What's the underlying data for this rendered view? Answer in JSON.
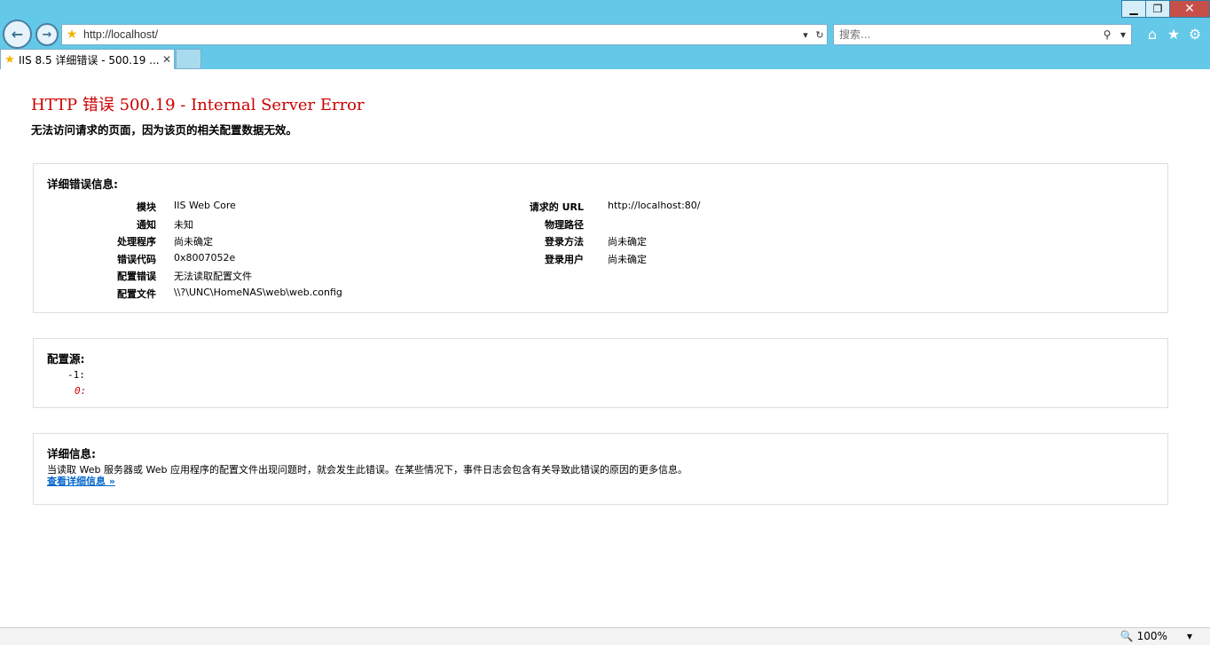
{
  "window": {
    "minimize": "▁",
    "restore": "❐",
    "close": "✕"
  },
  "nav": {
    "back_icon": "←",
    "forward_icon": "→"
  },
  "address": {
    "url": "http://localhost/",
    "dropdown": "▾",
    "refresh": "↻"
  },
  "search": {
    "placeholder": "搜索...",
    "search_icon": "⚲",
    "dropdown": "▾"
  },
  "toolbar": {
    "home_icon": "⌂",
    "favorites_icon": "★",
    "tools_icon": "⚙"
  },
  "tab": {
    "title": "IIS 8.5 详细错误 - 500.19 ...",
    "close": "✕"
  },
  "page": {
    "heading": "HTTP 错误 500.19 - Internal Server Error",
    "subheading": "无法访问请求的页面，因为该页的相关配置数据无效。"
  },
  "detailed_error": {
    "title": "详细错误信息:",
    "left": [
      {
        "key": "模块",
        "value": "IIS Web Core"
      },
      {
        "key": "通知",
        "value": "未知"
      },
      {
        "key": "处理程序",
        "value": "尚未确定"
      },
      {
        "key": "错误代码",
        "value": "0x8007052e"
      },
      {
        "key": "配置错误",
        "value": "无法读取配置文件"
      },
      {
        "key": "配置文件",
        "value": "\\\\?\\UNC\\HomeNAS\\web\\web.config"
      }
    ],
    "right": [
      {
        "key": "请求的 URL",
        "value": "http://localhost:80/"
      },
      {
        "key": "物理路径",
        "value": ""
      },
      {
        "key": "登录方法",
        "value": "尚未确定"
      },
      {
        "key": "登录用户",
        "value": "尚未确定"
      }
    ]
  },
  "config_source": {
    "title": "配置源:",
    "line_minus1": "-1:",
    "line_0": "0:"
  },
  "more_info": {
    "title": "详细信息:",
    "text": "当读取 Web 服务器或 Web 应用程序的配置文件出现问题时，就会发生此错误。在某些情况下，事件日志会包含有关导致此错误的原因的更多信息。",
    "link": "查看详细信息 »"
  },
  "status": {
    "zoom": "100%",
    "zoom_icon": "🔍",
    "zoom_dropdown": "▾"
  },
  "colors": {
    "chrome": "#64c8e8",
    "error_heading": "#cc0000",
    "link": "#0066cc"
  }
}
